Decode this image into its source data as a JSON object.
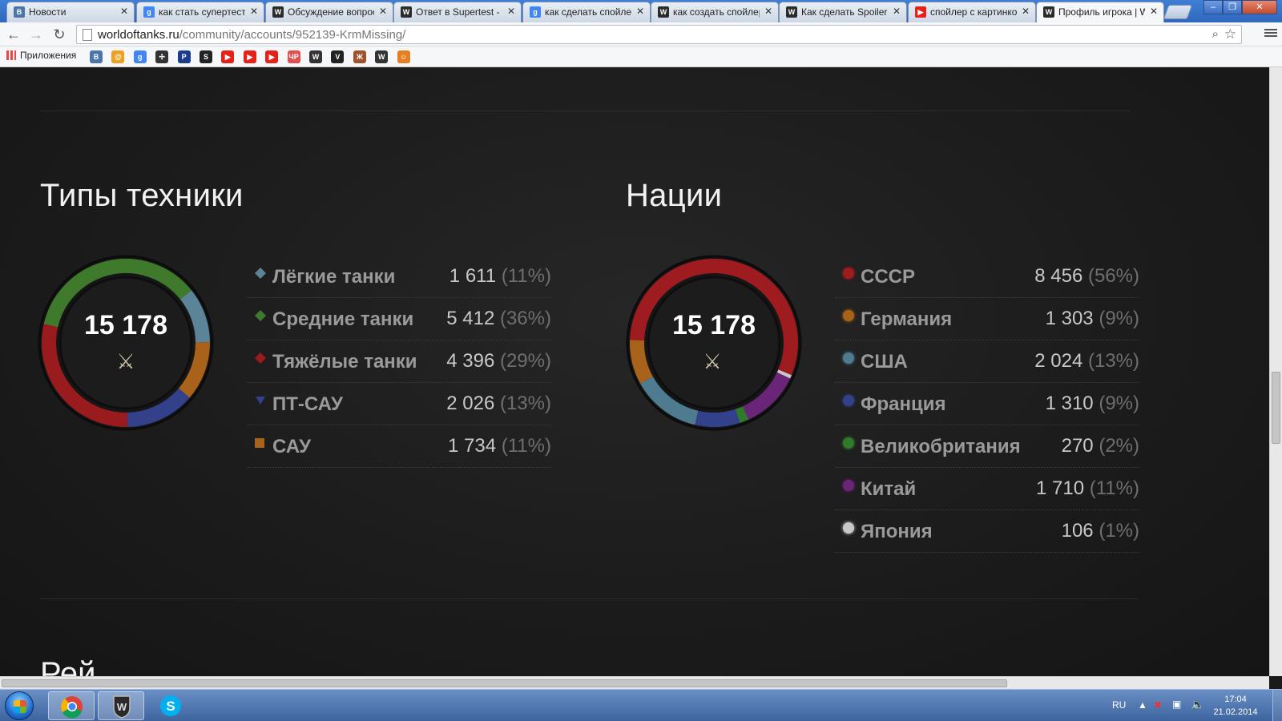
{
  "browser": {
    "tabs": [
      {
        "label": "Новости",
        "fav_color": "#4a76a8",
        "fav_text": "В"
      },
      {
        "label": "как стать супертестером",
        "fav_color": "#4285f4",
        "fav_text": "g"
      },
      {
        "label": "Обсуждение вопроса",
        "fav_color": "#2b2b2b",
        "fav_text": "W"
      },
      {
        "label": "Ответ в Supertest - World",
        "fav_color": "#2b2b2b",
        "fav_text": "W"
      },
      {
        "label": "как сделать спойлер",
        "fav_color": "#4285f4",
        "fav_text": "g"
      },
      {
        "label": "как создать спойлер",
        "fav_color": "#2b2b2b",
        "fav_text": "W"
      },
      {
        "label": "Как сделать Spoiler",
        "fav_color": "#2b2b2b",
        "fav_text": "W"
      },
      {
        "label": "спойлер с картинкой",
        "fav_color": "#e62117",
        "fav_text": "▶"
      },
      {
        "label": "Профиль игрока | World",
        "fav_color": "#2b2b2b",
        "fav_text": "W"
      }
    ],
    "url_host": "worldoftanks.ru",
    "url_path": "/community/accounts/952139-KrmMissing/",
    "bookmarks_apps_label": "Приложения",
    "bookmark_icons": [
      {
        "text": "В",
        "color": "#4a76a8"
      },
      {
        "text": "@",
        "color": "#f0a020"
      },
      {
        "text": "g",
        "color": "#4285f4"
      },
      {
        "text": "✢",
        "color": "#333333"
      },
      {
        "text": "P",
        "color": "#1a3c8a"
      },
      {
        "text": "S",
        "color": "#222222"
      },
      {
        "text": "▶",
        "color": "#e62117"
      },
      {
        "text": "▶",
        "color": "#e62117"
      },
      {
        "text": "▶",
        "color": "#e62117"
      },
      {
        "text": "ЧР",
        "color": "#e05050"
      },
      {
        "text": "W",
        "color": "#333333"
      },
      {
        "text": "V",
        "color": "#222222"
      },
      {
        "text": "Ж",
        "color": "#a0522d"
      },
      {
        "text": "W",
        "color": "#333333"
      },
      {
        "text": "☺",
        "color": "#e67e22"
      }
    ]
  },
  "vehicle_types": {
    "title": "Типы техники",
    "total": "15 178",
    "items": [
      {
        "name": "Лёгкие танки",
        "value": "1 611",
        "pct": "(11%)",
        "count": 1611,
        "color": "#5b8499",
        "icon": "light-tank-icon"
      },
      {
        "name": "Средние танки",
        "value": "5 412",
        "pct": "(36%)",
        "count": 5412,
        "color": "#3f7a2c",
        "icon": "medium-tank-icon"
      },
      {
        "name": "Тяжёлые танки",
        "value": "4 396",
        "pct": "(29%)",
        "count": 4396,
        "color": "#9a1b1e",
        "icon": "heavy-tank-icon"
      },
      {
        "name": "ПТ-САУ",
        "value": "2 026",
        "pct": "(13%)",
        "count": 2026,
        "color": "#33418a",
        "icon": "td-icon"
      },
      {
        "name": "САУ",
        "value": "1 734",
        "pct": "(11%)",
        "count": 1734,
        "color": "#a9621a",
        "icon": "spg-icon"
      }
    ],
    "donut_order": [
      1,
      0,
      4,
      3,
      2
    ]
  },
  "nations": {
    "title": "Нации",
    "total": "15 178",
    "items": [
      {
        "name": "СССР",
        "value": "8 456",
        "pct": "(56%)",
        "count": 8456,
        "color": "#9e1b1f",
        "icon": "ussr-dot-icon"
      },
      {
        "name": "Германия",
        "value": "1 303",
        "pct": "(9%)",
        "count": 1303,
        "color": "#a9621a",
        "icon": "germany-dot-icon"
      },
      {
        "name": "США",
        "value": "2 024",
        "pct": "(13%)",
        "count": 2024,
        "color": "#4f7b91",
        "icon": "usa-dot-icon"
      },
      {
        "name": "Франция",
        "value": "1 310",
        "pct": "(9%)",
        "count": 1310,
        "color": "#33418a",
        "icon": "france-dot-icon"
      },
      {
        "name": "Великобритания",
        "value": "270",
        "pct": "(2%)",
        "count": 270,
        "color": "#2f7a2b",
        "icon": "uk-dot-icon"
      },
      {
        "name": "Китай",
        "value": "1 710",
        "pct": "(11%)",
        "count": 1710,
        "color": "#6a2478",
        "icon": "china-dot-icon"
      },
      {
        "name": "Япония",
        "value": "106",
        "pct": "(1%)",
        "count": 106,
        "color": "#c8c8c8",
        "icon": "japan-dot-icon"
      }
    ],
    "donut_order": [
      0,
      6,
      5,
      4,
      3,
      2,
      1
    ]
  },
  "next_section_partial": "Рей",
  "taskbar": {
    "lang": "RU",
    "time": "17:04",
    "date": "21.02.2014"
  }
}
